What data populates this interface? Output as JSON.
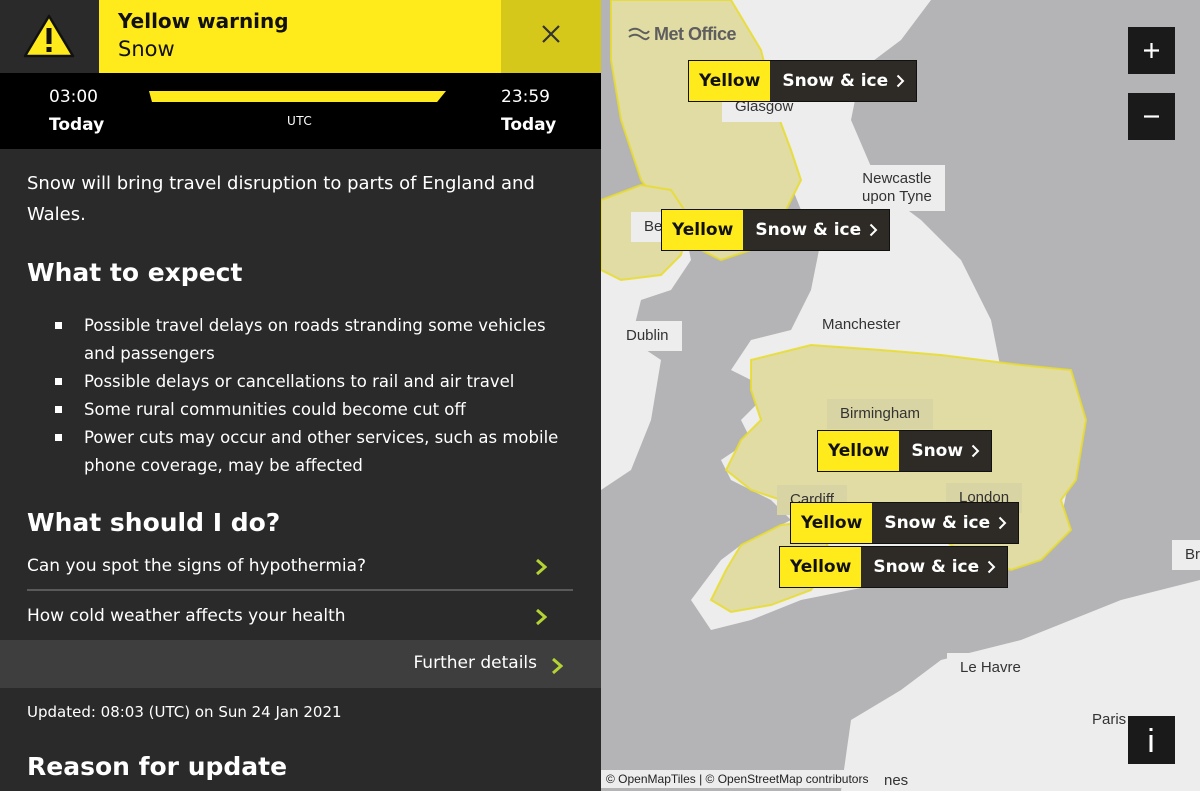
{
  "warning": {
    "level_title": "Yellow warning",
    "type": "Snow",
    "colors": {
      "yellow": "#ffeb1c",
      "dark": "#2a2a2a",
      "close_bg": "#d6c81b"
    }
  },
  "timebar": {
    "start_time": "03:00",
    "start_day": "Today",
    "end_time": "23:59",
    "end_day": "Today",
    "zone": "UTC"
  },
  "intro": "Snow will bring travel disruption to parts of England and Wales.",
  "what_to_expect": {
    "heading": "What to expect",
    "items": [
      "Possible travel delays on roads stranding some vehicles and passengers",
      "Possible delays or cancellations to rail and air travel",
      "Some rural communities could become cut off",
      "Power cuts may occur and other services, such as mobile phone coverage, may be affected"
    ]
  },
  "what_to_do": {
    "heading": "What should I do?",
    "links": [
      "Can you spot the signs of hypothermia?",
      "How cold weather affects your health"
    ]
  },
  "further_details": "Further details",
  "updated": "Updated: 08:03 (UTC) on Sun 24 Jan 2021",
  "reason_heading": "Reason for update",
  "map": {
    "brand": "Met Office",
    "attribution": "© OpenMapTiles | © OpenStreetMap contributors",
    "cities": {
      "glasgow": "Glasgow",
      "belfast": "Be",
      "newcastle_1": "Newcastle",
      "newcastle_2": "upon Tyne",
      "dublin": "Dublin",
      "manchester": "Manchester",
      "birmingham": "Birmingham",
      "cardiff": "Cardiff",
      "london": "London",
      "le_havre": "Le Havre",
      "paris": "Paris",
      "brussels": "Br",
      "rennes": "nes"
    },
    "warnings": [
      {
        "level": "Yellow",
        "type": "Snow & ice"
      },
      {
        "level": "Yellow",
        "type": "Snow & ice"
      },
      {
        "level": "Yellow",
        "type": "Snow"
      },
      {
        "level": "Yellow",
        "type": "Snow & ice"
      },
      {
        "level": "Yellow",
        "type": "Snow & ice"
      }
    ],
    "zoom_in_symbol": "+",
    "zoom_out_symbol": "−",
    "icons": [
      "warning-triangle-icon",
      "close-icon",
      "chevron-right-icon",
      "plus-icon",
      "minus-icon",
      "info-icon"
    ]
  }
}
